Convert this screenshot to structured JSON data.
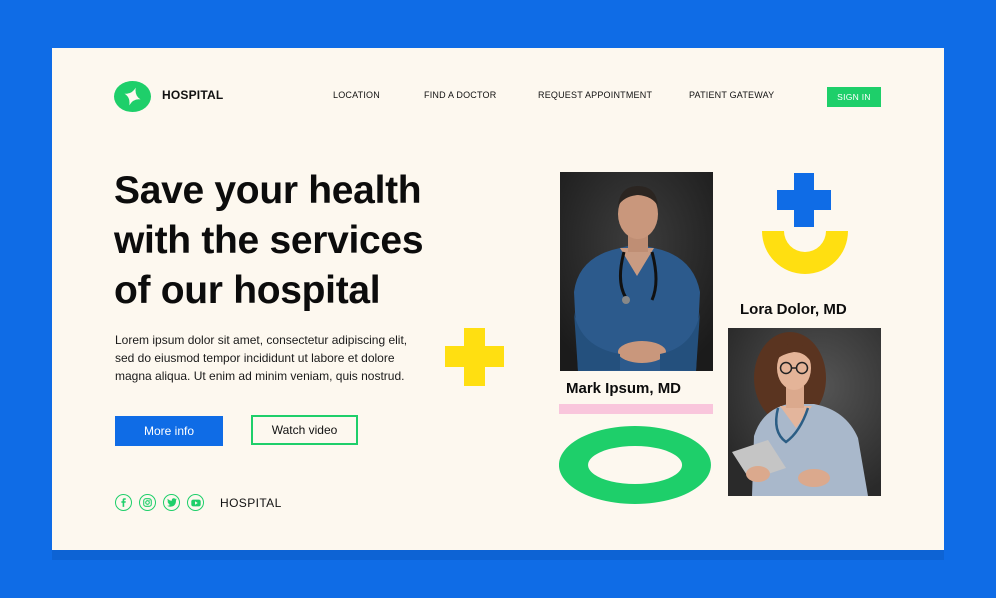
{
  "header": {
    "brand": "HOSPITAL",
    "nav": [
      "LOCATION",
      "FIND A DOCTOR",
      "REQUEST APPOINTMENT",
      "PATIENT GATEWAY"
    ],
    "signin_label": "SIGN IN"
  },
  "hero": {
    "headline_line1": "Save your health",
    "headline_line2": "with the services",
    "headline_line3": "of our hospital",
    "body_line1": "Lorem ipsum dolor sit amet, consectetur adipiscing elit,",
    "body_line2": "sed do eiusmod tempor incididunt ut labore et dolore",
    "body_line3": "magna aliqua. Ut enim ad minim veniam, quis nostrud.",
    "more_info_label": "More info",
    "watch_video_label": "Watch video"
  },
  "footer": {
    "social_icons": [
      "facebook-icon",
      "instagram-icon",
      "twitter-icon",
      "youtube-icon"
    ],
    "label": "HOSPITAL"
  },
  "doctors": [
    {
      "name": "Mark Ipsum, MD"
    },
    {
      "name": "Lora Dolor, MD"
    }
  ],
  "colors": {
    "background": "#0f6ce6",
    "card": "#fdf8ef",
    "accent_green": "#1ecf6a",
    "accent_yellow": "#ffdf11",
    "accent_blue": "#0f6ce6",
    "accent_pink": "#f9c6dc"
  }
}
